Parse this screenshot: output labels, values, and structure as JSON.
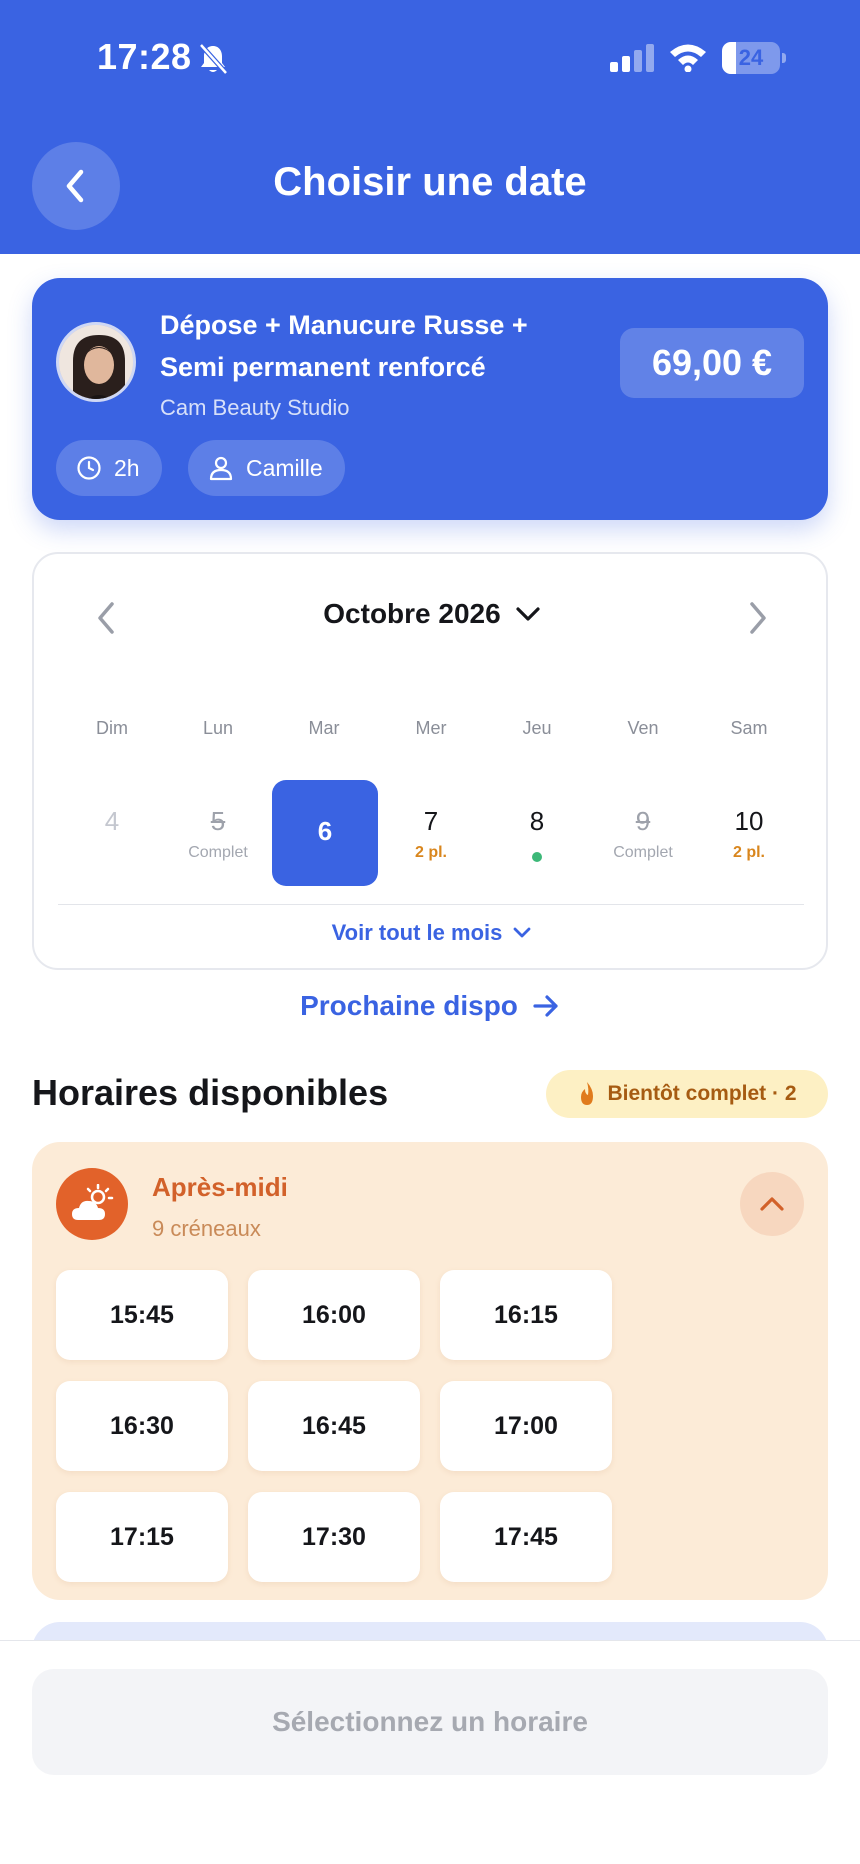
{
  "status_bar": {
    "time": "17:28",
    "battery": "24",
    "battery_level": 0.24
  },
  "header": {
    "title": "Choisir une date"
  },
  "service": {
    "name": "Dépose + Manucure Russe + Semi permanent renforcé",
    "studio": "Cam Beauty Studio",
    "price": "69,00 €",
    "duration": "2h",
    "staff": "Camille"
  },
  "calendar": {
    "month": "Octobre 2026",
    "weekdays": [
      "Dim",
      "Lun",
      "Mar",
      "Mer",
      "Jeu",
      "Ven",
      "Sam"
    ],
    "days": [
      {
        "num": "4",
        "sub": "",
        "state": "disabled"
      },
      {
        "num": "5",
        "sub": "Complet",
        "state": "full"
      },
      {
        "num": "6",
        "sub": "",
        "state": "selected"
      },
      {
        "num": "7",
        "sub": "2 pl.",
        "state": "few"
      },
      {
        "num": "8",
        "sub": "",
        "state": "available"
      },
      {
        "num": "9",
        "sub": "Complet",
        "state": "full"
      },
      {
        "num": "10",
        "sub": "2 pl.",
        "state": "few"
      }
    ],
    "see_month": "Voir tout le mois"
  },
  "next_available": "Prochaine dispo",
  "slots_section": {
    "title": "Horaires disponibles",
    "badge": "Bientôt complet · 2",
    "period": {
      "title": "Après-midi",
      "count": "9 créneaux",
      "times": [
        "15:45",
        "16:00",
        "16:15",
        "16:30",
        "16:45",
        "17:00",
        "17:15",
        "17:30",
        "17:45"
      ]
    }
  },
  "cta": {
    "label": "Sélectionnez un horaire"
  },
  "colors": {
    "primary": "#3a63e2",
    "afternoon": "#e2622a",
    "available": "#3cb878",
    "few": "#d9861d"
  }
}
